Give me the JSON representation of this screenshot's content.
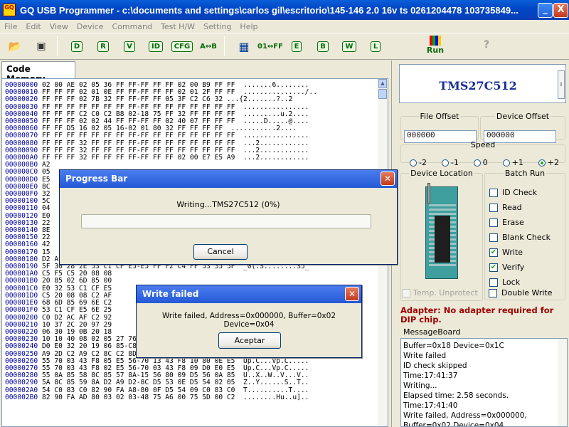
{
  "window": {
    "title": "GQ USB Programmer - c:\\documents and settings\\carlos gil\\escritorio\\145-146 2.0 16v ts 0261204478 103735849...",
    "app_icon_text": "GQ",
    "minimize_label": "_",
    "close_label": "X"
  },
  "menu": [
    "File",
    "Edit",
    "View",
    "Device",
    "Command",
    "Test H/W",
    "Setting",
    "Help"
  ],
  "toolbar": {
    "tools": [
      "D",
      "R",
      "V",
      "ID",
      "CFG",
      "A↔B",
      "01↔FF",
      "E",
      "B",
      "W",
      "L"
    ],
    "run_label": "Run",
    "help_label": "?"
  },
  "tabs": {
    "code_memory": "Code Memory"
  },
  "hex_lines": [
    "00000000 02 00 AE 02 05 36 FF FF-FF FF FF 02 00 B9 FF FF  .......6........",
    "00000010 FF FF FF 02 01 0E FF FF-FF FF FF 02 01 2F FF FF  .............../..",
    "00000020 FF FF FF 02 7B 32 FF FF-FF FF 05 3F C2 C6 32 ...{2.......?..2",
    "00000030 FF FF FF FF FF FF FF FF-FF FF FF FF FF FF FF FF  ................",
    "00000040 FF FF FF C2 C0 C2 B8 02-18 75 FF 32 FF FF FF FF  .........u.2....",
    "00000050 FF FF FF 02 02 44 FF FF-FF FF 02 40 07 FF FF FF  .....D.....@....",
    "00000060 FF FF D5 16 02 05 16-02 01 80 32 FF FF FF FF  ...........2....",
    "00000070 FF FF FF FF FF FF FF FF-FF FF FF FF FF FF FF FF  ................",
    "00000080 FF FF FF 32 FF FF FF FF-FF FF FF FF FF FF FF FF  ...2............",
    "00000090 FF FF FF 32 FF FF FF FF-FF FF FF FF FF FF FF FF  ...2............",
    "000000A0 FF FF FF 32 FF FF FF FF-FF FF FF 02 00 E7 E5 A9  ...2............",
    "000000B0 A2",
    "000000C0 05",
    "000000D0 E5",
    "000000E0 8C",
    "000000F0 32",
    "00000100 5C",
    "00000110 04",
    "00000120 E0",
    "00000130 22",
    "00000140 8E",
    "00000150 22",
    "00000160 42",
    "00000170 15",
    "00000180 D2 AE D2 BE D5 6C 03 02-05 27 C0 E0 C0 D0 10 27  .....l...'.....'",
    "00000190 5F 30 28 2E 53 C1 CF E5-E5 FF F2 C4 FF 53 35 5F  _0(.S........S5_",
    "000001A0 C5 F5 C5 20 08 08",
    "000001B0 20 85 02 6D 85 00",
    "000001C0 E0 32 53 C1 CF E5",
    "000001D0 C5 20 08 08 C2 AF",
    "000001E0 68 6D 85 69 6E C2",
    "000001F0 53 C1 CF E5 6E 25",
    "00000200 C0 D2 AC AF C2 92",
    "00000210 10 37 2C 20 97 29",
    "00000220 06 30 19 0B 20 18",
    "00000230 10 10 40 08 02 05 27 76-00 85 FB C8 4F 00 E0 F8  ..@...'v....O...",
    "00000240 D0 E0 32 20 19 06 85-C8 39 02 04 35 15 52 30  ..2 .....9..5.R0",
    "00000250 A9 2D C2 A9 C2 8C C2 8D-B2 0C C0 E0 30 0A 10 E5  .-..........0...",
    "00000260 55 70 03 43 F8 05 E5 56-70 13 43 F8 10 80 0E E5  Up.C...Vp.C.....",
    "00000270 55 70 03 43 F8 02 E5 56-70 03 43 F8 09 D0 E0 E5  Up.C...Vp.C.....",
    "00000280 55 0A 85 58 8C 85 57 8A-15 56 80 09 D5 56 0A 85  U..X..W..V...V..",
    "00000290 5A 8C 85 59 8A D2 A9 D2-8C D5 53 0E D5 54 02 05  Z..Y......S..T..",
    "000002A0 54 C0 83 C0 82 90 FA A8-80 0F D5 54 09 C0 83 C0  T..........T....",
    "000002B0 82 90 FA AD 80 03 02 03-48 75 A6 00 75 5D 00 C2  ........Hu..u].."
  ],
  "device": {
    "chip_name": "TMS27C512",
    "file_offset_label": "File Offset",
    "file_offset_value": "000000",
    "device_offset_label": "Device Offset",
    "device_offset_value": "000000",
    "speed_label": "Speed",
    "speed_options": [
      "-2",
      "-1",
      "0",
      "+1",
      "+2"
    ],
    "speed_selected": "+2",
    "device_location_label": "Device Location",
    "batch_run_label": "Batch Run",
    "batch_items": [
      {
        "label": "ID Check",
        "checked": false
      },
      {
        "label": "Read",
        "checked": false
      },
      {
        "label": "Erase",
        "checked": false
      },
      {
        "label": "Blank Check",
        "checked": false
      },
      {
        "label": "Write",
        "checked": true
      },
      {
        "label": "Verify",
        "checked": true
      },
      {
        "label": "Lock",
        "checked": false
      }
    ],
    "temp_unprotect_label": "Temp. Unprotect",
    "double_write_label": "Double Write",
    "adapter_note": "Adapter: No adapter required for DIP chip.",
    "messageboard_label": "MessageBoard",
    "messages": [
      "Buffer=0x18 Device=0x1C",
      "Write failed",
      "ID check skipped",
      "Time:17:41:37",
      "Writing...",
      "Elapsed time: 2.58 seconds.",
      "Time:17:41:40",
      "Write failed, Address=0x000000,",
      "Buffer=0x02 Device=0x04"
    ]
  },
  "progress_dialog": {
    "title": "Progress Bar",
    "text": "Writing...TMS27C512 (0%)",
    "progress": 0,
    "cancel_label": "Cancel"
  },
  "write_failed_dialog": {
    "title": "Write failed",
    "message": "Write failed, Address=0x000000, Buffer=0x02 Device=0x04",
    "accept_label": "Aceptar"
  },
  "colors": {
    "title_bar": "#0047C6",
    "chip_name": "#1A2E9A",
    "adapter_note": "#A00000",
    "progress_fill": "#2CB42C"
  }
}
